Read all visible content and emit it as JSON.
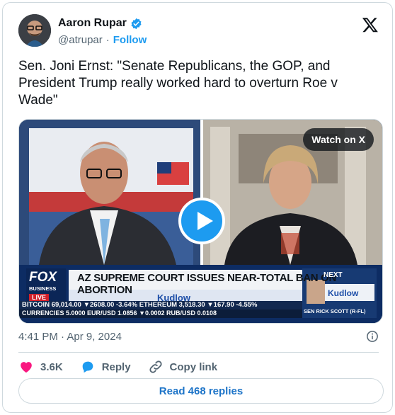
{
  "author": {
    "name": "Aaron Rupar",
    "handle": "@atrupar",
    "separator": "·",
    "follow_label": "Follow"
  },
  "tweet": {
    "text": "Sen. Joni Ernst: \"Senate Republicans, the GOP, and President Trump really worked hard to overturn Roe v Wade\"",
    "timestamp": "4:41 PM · Apr 9, 2024"
  },
  "media": {
    "watch_label": "Watch on X",
    "overlay": {
      "network": "FOX",
      "network_sub": "BUSINESS",
      "live": "LIVE",
      "headline": "AZ SUPREME COURT ISSUES NEAR-TOTAL BAN ON ABORTION",
      "show": "Kudlow",
      "ticker_1": "BITCOIN  69,014.00 ▼2608.00 -3.64%  ETHEREUM  3,518.30 ▼167.90 -4.55%",
      "ticker_2": "CURRENCIES  5.0000  EUR/USD  1.0856 ▼0.0002  RUB/USD  0.0108",
      "next_label": "NEXT",
      "next_show": "Kudlow",
      "next_guest": "SEN RICK SCOTT (R-FL)"
    }
  },
  "actions": {
    "like_count": "3.6K",
    "reply_label": "Reply",
    "copy_link_label": "Copy link"
  },
  "read_replies_label": "Read 468 replies",
  "colors": {
    "accent": "#1d9bf0",
    "like": "#f91880",
    "muted": "#536471",
    "border": "#cfd9de"
  }
}
